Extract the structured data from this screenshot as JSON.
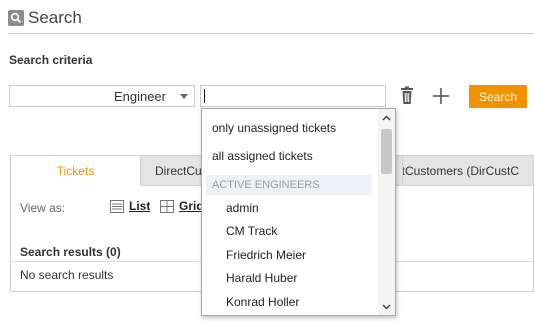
{
  "header": {
    "title": "Search",
    "icon": "search-icon"
  },
  "criteria": {
    "section_title": "Search criteria",
    "field_value": "Engineer",
    "value_input": "",
    "search_label": "Search",
    "accent_color": "#f39200"
  },
  "dropdown": {
    "option_unassigned": "only unassigned tickets",
    "option_assigned": "all assigned tickets",
    "group_label": "ACTIVE ENGINEERS",
    "engineers": [
      "admin",
      "CM Track",
      "Friedrich Meier",
      "Harald Huber",
      "Konrad Holler"
    ]
  },
  "tabs": {
    "tab1": "Tickets",
    "tab2": "DirectCustomers (DirCustC",
    "tab3": "rectCustomers (DirCustC"
  },
  "view": {
    "label": "View as:",
    "list": "List",
    "grid": "Grid"
  },
  "results": {
    "title": "Search results (0)",
    "empty": "No search results"
  }
}
